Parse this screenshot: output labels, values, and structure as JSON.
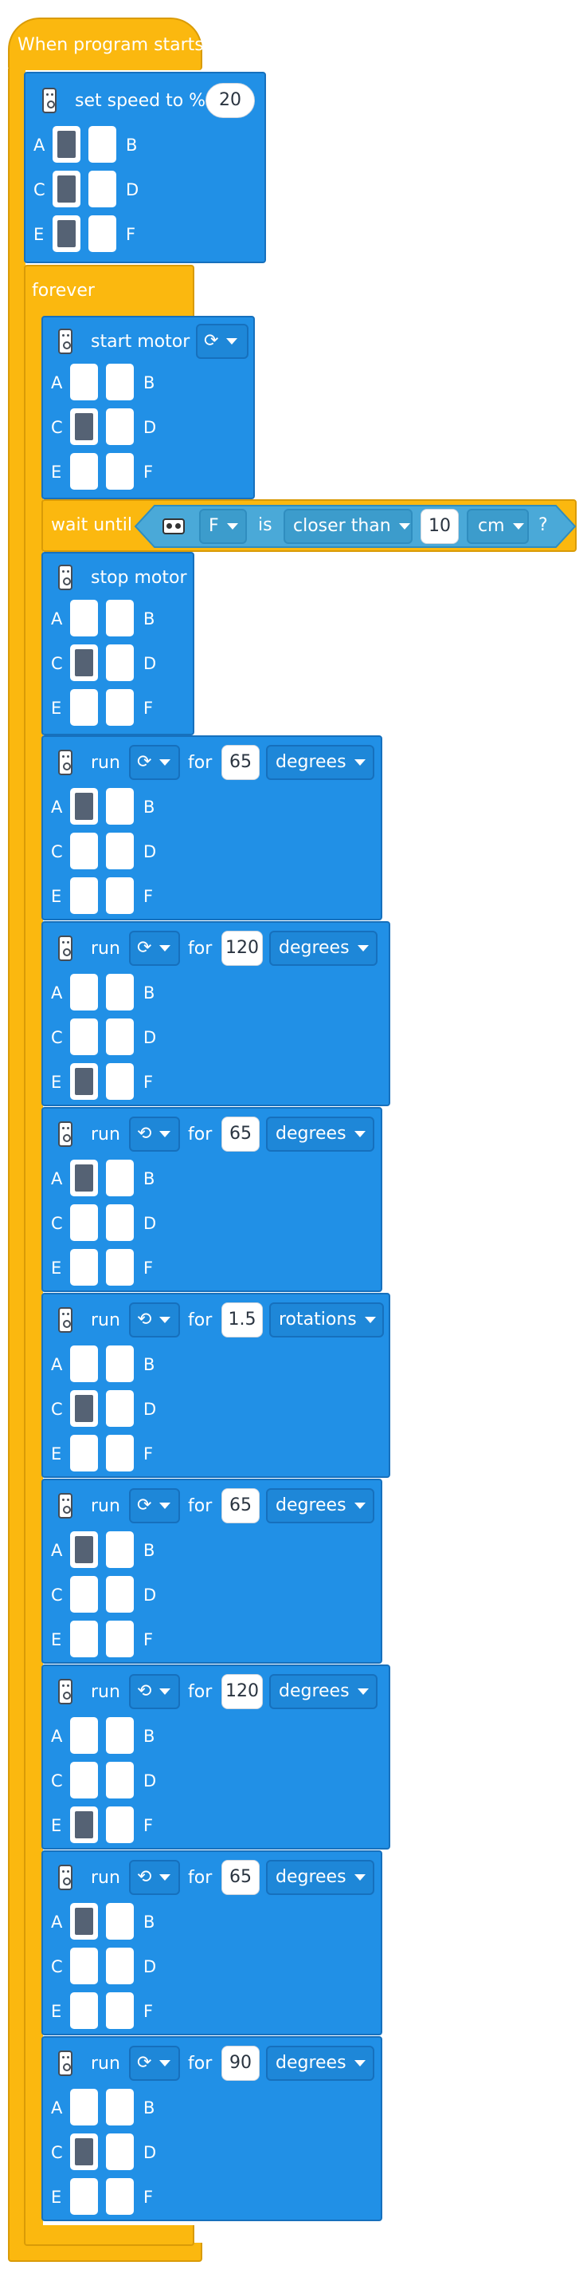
{
  "hat_label": "When program starts",
  "port_labels": {
    "A": "A",
    "B": "B",
    "C": "C",
    "D": "D",
    "E": "E",
    "F": "F"
  },
  "set_speed": {
    "label": "set speed to %",
    "value": "20",
    "ports_selected": [
      "A",
      "C",
      "E"
    ]
  },
  "forever_label": "forever",
  "start_motor": {
    "label": "start motor",
    "direction_icon": "clockwise-icon",
    "ports_selected": [
      "C"
    ]
  },
  "wait_until": {
    "label": "wait until",
    "sensor_icon": "distance-sensor-icon",
    "port": "F",
    "is_label": "is",
    "comparison": "closer than",
    "value": "10",
    "unit": "cm",
    "question": "?"
  },
  "stop_motor": {
    "label": "stop motor",
    "ports_selected": [
      "C"
    ]
  },
  "run_label": "run",
  "for_label": "for",
  "run_blocks": [
    {
      "direction_icon": "clockwise-icon",
      "value": "65",
      "unit": "degrees",
      "ports_selected": [
        "A"
      ]
    },
    {
      "direction_icon": "clockwise-icon",
      "value": "120",
      "unit": "degrees",
      "ports_selected": [
        "E"
      ]
    },
    {
      "direction_icon": "counterclockwise-icon",
      "value": "65",
      "unit": "degrees",
      "ports_selected": [
        "A"
      ]
    },
    {
      "direction_icon": "counterclockwise-icon",
      "value": "1.5",
      "unit": "rotations",
      "ports_selected": [
        "C"
      ]
    },
    {
      "direction_icon": "clockwise-icon",
      "value": "65",
      "unit": "degrees",
      "ports_selected": [
        "A"
      ]
    },
    {
      "direction_icon": "counterclockwise-icon",
      "value": "120",
      "unit": "degrees",
      "ports_selected": [
        "E"
      ]
    },
    {
      "direction_icon": "counterclockwise-icon",
      "value": "65",
      "unit": "degrees",
      "ports_selected": [
        "A"
      ]
    },
    {
      "direction_icon": "clockwise-icon",
      "value": "90",
      "unit": "degrees",
      "ports_selected": [
        "C"
      ]
    }
  ],
  "colors": {
    "control_yellow": "#fbb80f",
    "motor_blue": "#2190e6",
    "selected_port": "#556274"
  }
}
